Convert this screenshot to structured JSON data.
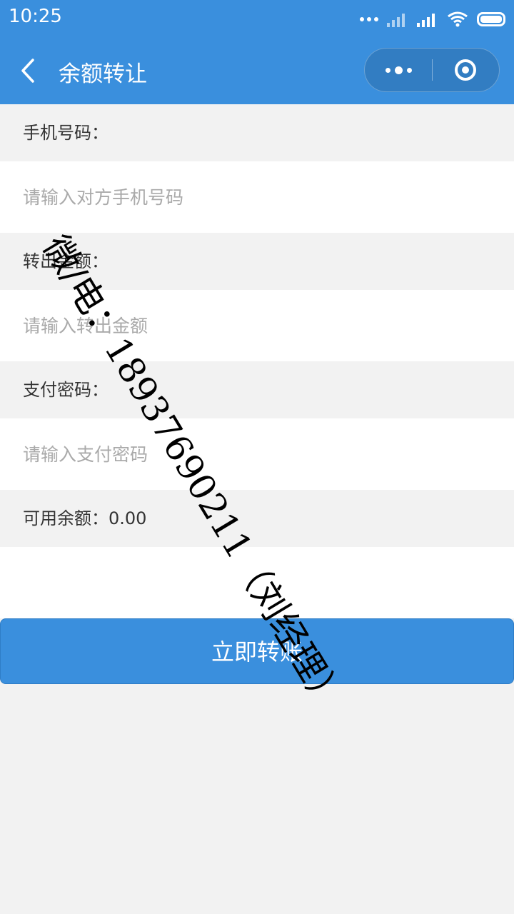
{
  "status": {
    "time": "10:25"
  },
  "nav": {
    "title": "余额转让"
  },
  "form": {
    "phone_label": "手机号码：",
    "phone_placeholder": "请输入对方手机号码",
    "amount_label": "转出金额：",
    "amount_placeholder": "请输入转出金额",
    "password_label": "支付密码：",
    "password_placeholder": "请输入支付密码",
    "balance_text": "可用余额：0.00"
  },
  "submit_label": "立即转账",
  "watermark_text": "微/电：18937690211（刘经理）",
  "colors": {
    "accent": "#3a8fdd",
    "background": "#f2f2f2",
    "placeholder": "#aaaaaa"
  },
  "icons": [
    "back-arrow-icon",
    "more-dots-icon",
    "close-ring-icon",
    "wifi-icon",
    "signal-icon",
    "battery-icon"
  ]
}
